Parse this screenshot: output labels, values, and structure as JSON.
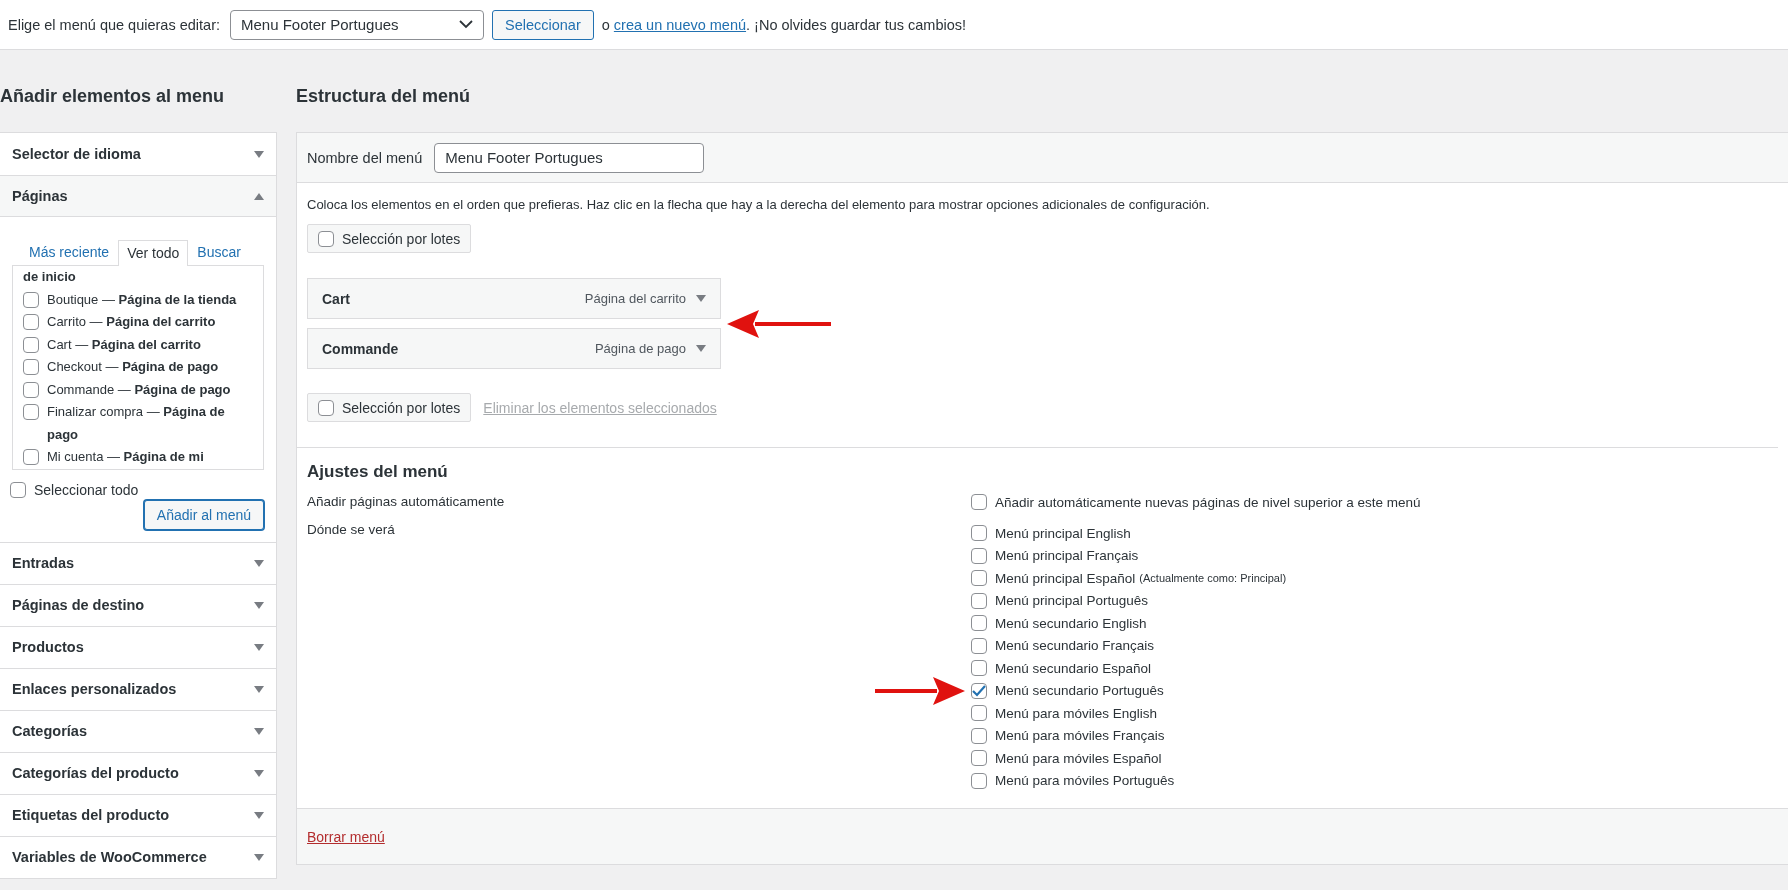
{
  "top_bar": {
    "label": "Elige el menú que quieras editar:",
    "menu_select": {
      "value": "Menu Footer Portugues"
    },
    "select_button": "Seleccionar",
    "text_before_link": "o",
    "create_link": "crea un nuevo menú",
    "text_after_link": ". ¡No olvides guardar tus cambios!"
  },
  "add_items": {
    "title": "Añadir elementos al menu",
    "sections": [
      {
        "title": "Selector de idioma",
        "expanded": false
      },
      {
        "title": "Páginas",
        "expanded": true,
        "tabs": [
          {
            "label": "Más reciente",
            "selected": false
          },
          {
            "label": "Ver todo",
            "selected": true
          },
          {
            "label": "Buscar",
            "selected": false
          }
        ],
        "items": [
          {
            "kind": "fragment",
            "label": "de inicio"
          },
          {
            "kind": "checkbox",
            "label": "Boutique — **Página de la tienda**",
            "checked": false
          },
          {
            "kind": "checkbox",
            "label": "Carrito — **Página del carrito**",
            "checked": false
          },
          {
            "kind": "checkbox",
            "label": "Cart — **Página del carrito**",
            "checked": false
          },
          {
            "kind": "checkbox",
            "label": "Checkout — **Página de pago**",
            "checked": false
          },
          {
            "kind": "checkbox",
            "label": "Commande — **Página de pago**",
            "checked": false
          },
          {
            "kind": "checkbox",
            "label": "Finalizar compra — **Página de pago**",
            "checked": false
          },
          {
            "kind": "checkbox",
            "label": "Mi cuenta — **Página de mi**",
            "checked": false
          }
        ],
        "select_all": {
          "label": "Seleccionar todo",
          "checked": false
        },
        "add_button": "Añadir al menú"
      },
      {
        "title": "Entradas",
        "expanded": false
      },
      {
        "title": "Páginas de destino",
        "expanded": false
      },
      {
        "title": "Productos",
        "expanded": false
      },
      {
        "title": "Enlaces personalizados",
        "expanded": false
      },
      {
        "title": "Categorías",
        "expanded": false
      },
      {
        "title": "Categorías del producto",
        "expanded": false
      },
      {
        "title": "Etiquetas del producto",
        "expanded": false
      },
      {
        "title": "Variables de WooCommerce",
        "expanded": false
      }
    ]
  },
  "structure": {
    "title": "Estructura del menú",
    "name_label": "Nombre del menú",
    "name_value": "Menu Footer Portugues",
    "instructions": "Coloca los elementos en el orden que prefieras. Haz clic en la flecha que hay a la derecha del elemento para mostrar opciones adicionales de configuración.",
    "bulk_top": {
      "label": "Selección por lotes",
      "checked": false
    },
    "menu_items": [
      {
        "title": "Cart",
        "type": "Página del carrito"
      },
      {
        "title": "Commande",
        "type": "Página de pago"
      }
    ],
    "bulk_bottom": {
      "label": "Selección por lotes",
      "checked": false
    },
    "remove_selected": "Eliminar los elementos seleccionados",
    "settings": {
      "title": "Ajustes del menú",
      "auto_add_label": "Añadir páginas automáticamente",
      "auto_add": {
        "label": "Añadir automáticamente nuevas páginas de nivel superior a este menú",
        "checked": false
      },
      "locations_label": "Dónde se verá",
      "locations": [
        {
          "label": "Menú principal English",
          "checked": false
        },
        {
          "label": "Menú principal Français",
          "checked": false
        },
        {
          "label": "Menú principal Español",
          "note": "(Actualmente como: Principal)",
          "checked": false
        },
        {
          "label": "Menú principal Português",
          "checked": false
        },
        {
          "label": "Menú secundario English",
          "checked": false
        },
        {
          "label": "Menú secundario Français",
          "checked": false
        },
        {
          "label": "Menú secundario Español",
          "checked": false
        },
        {
          "label": "Menú secundario Português",
          "checked": true
        },
        {
          "label": "Menú para móviles English",
          "checked": false
        },
        {
          "label": "Menú para móviles Français",
          "checked": false
        },
        {
          "label": "Menú para móviles Español",
          "checked": false
        },
        {
          "label": "Menú para móviles Português",
          "checked": false
        }
      ]
    },
    "delete_link": "Borrar menú"
  }
}
